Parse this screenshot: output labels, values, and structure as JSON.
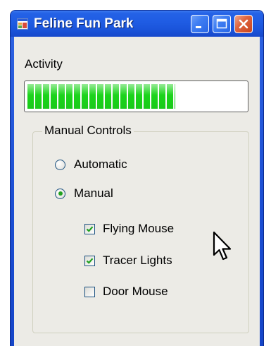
{
  "window": {
    "title": "Feline Fun Park",
    "icon": "application-icon",
    "controls": {
      "minimize": "minimize-icon",
      "maximize": "maximize-icon",
      "close": "close-icon"
    }
  },
  "activity": {
    "label": "Activity",
    "progress_fraction": 0.68
  },
  "manual_controls": {
    "legend": "Manual Controls",
    "modes": [
      {
        "label": "Automatic",
        "selected": false
      },
      {
        "label": "Manual",
        "selected": true
      }
    ],
    "toys": [
      {
        "label": "Flying Mouse",
        "checked": true
      },
      {
        "label": "Tracer Lights",
        "checked": true
      },
      {
        "label": "Door Mouse",
        "checked": false
      }
    ]
  },
  "colors": {
    "titlebar": "#1f5ce3",
    "client_background": "#ecebe6",
    "progress_fill": "#1bd41b",
    "close_button": "#e06640",
    "radio_dot": "#21a121",
    "check_mark": "#21a121"
  }
}
